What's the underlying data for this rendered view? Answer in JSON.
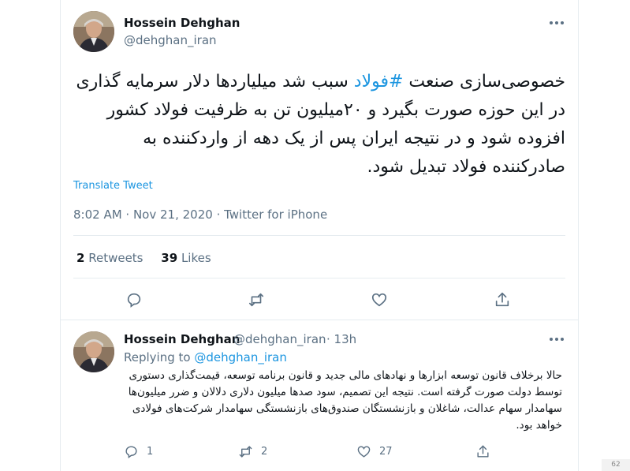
{
  "main_tweet": {
    "author_name": "Hossein Dehghan",
    "author_handle": "@dehghan_iran",
    "text_before": "خصوصی‌سازی صنعت ",
    "hashtag": "#فولاد",
    "text_after": " سبب شد میلیاردها دلار سرمایه گذاری در این حوزه صورت بگیرد و ۲۰میلیون تن به ظرفیت فولاد کشور افزوده شود و در نتیجه ایران پس از یک دهه از واردکننده به صادرکننده فولاد تبدیل شود.",
    "translate_label": "Translate Tweet",
    "timestamp": "8:02 AM · Nov 21, 2020 · Twitter for iPhone",
    "retweets_count": "2",
    "retweets_label": "Retweets",
    "likes_count": "39",
    "likes_label": "Likes"
  },
  "reply_tweet": {
    "author_name": "Hossein Dehghan",
    "author_handle": "@dehghan_iran",
    "time": "· 13h",
    "replying_prefix": "Replying to",
    "replying_to": "@dehghan_iran",
    "text": "حالا برخلاف قانون توسعه ابزارها و نهادهای مالی جدید و قانون برنامه توسعه، قیمت‌گذاری دستوری توسط دولت صورت گرفته است. نتیجه این تصمیم، سود صدها میلیون دلاری دلالان و ضرر میلیون‌ها سهامدار سهام عدالت، شاغلان و بازنشستگان صندوق‌های بازنشستگی سهامدار شرکت‌های فولادی خواهد بود.",
    "reply_count": "1",
    "retweet_count": "2",
    "like_count": "27"
  },
  "icons": {
    "more": "more-dots-icon",
    "reply": "reply-bubble-icon",
    "retweet": "retweet-icon",
    "like": "heart-icon",
    "share": "share-icon"
  },
  "colors": {
    "link": "#1b95e0",
    "secondary_text": "#5b7083",
    "border": "#e6ecf0"
  },
  "scroll_badge": "62"
}
